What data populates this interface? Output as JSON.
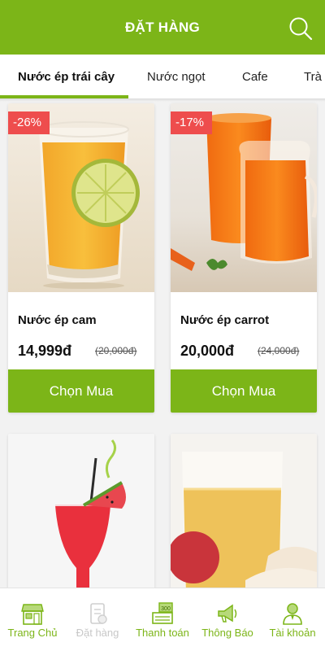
{
  "header": {
    "title": "ĐẶT HÀNG"
  },
  "tabs": [
    {
      "label": "Nước ép trái cây"
    },
    {
      "label": "Nước ngọt"
    },
    {
      "label": "Cafe"
    },
    {
      "label": "Trà"
    }
  ],
  "products": [
    {
      "name": "Nước ép cam",
      "price": "14,999đ",
      "old_price": "(20,000đ)",
      "discount": "-26%",
      "button": "Chọn Mua"
    },
    {
      "name": "Nước ép carrot",
      "price": "20,000đ",
      "old_price": "(24,000đ)",
      "discount": "-17%",
      "button": "Chọn Mua"
    }
  ],
  "bottom_nav": [
    {
      "label": "Trang Chủ",
      "icon": "store-icon"
    },
    {
      "label": "Đặt hàng",
      "icon": "order-icon"
    },
    {
      "label": "Thanh toán",
      "icon": "cash-register-icon"
    },
    {
      "label": "Thông Báo",
      "icon": "megaphone-icon"
    },
    {
      "label": "Tài khoản",
      "icon": "user-icon"
    }
  ],
  "colors": {
    "accent": "#7cb518",
    "discount": "#ee4d4d"
  }
}
